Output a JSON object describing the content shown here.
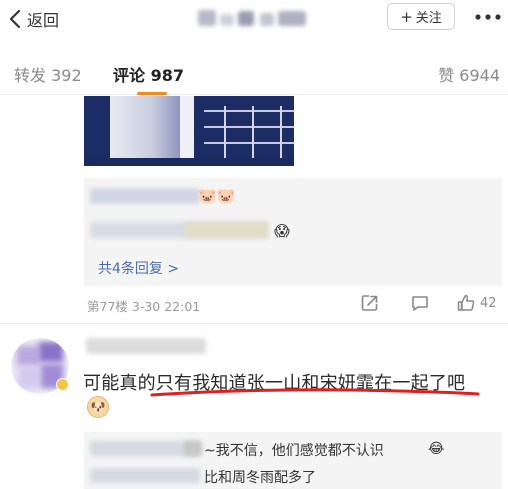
{
  "header": {
    "back_label": "返回",
    "follow_label": "关注"
  },
  "tabs": {
    "repost": "转发 392",
    "comment": "评论 987",
    "like": "赞 6944"
  },
  "prev_comment": {
    "emoji_a": "🐷🐷",
    "emoji_b": "😱",
    "more_replies": "共4条回复 >",
    "meta": "第77楼 3-30 22:01",
    "like_count": "42"
  },
  "comment": {
    "text": "可能真的只有我知道张一山和宋妍霏在一起了吧",
    "emoji": "🐶",
    "replies": [
      {
        "text": "~我不信，他们感觉都不认识",
        "emoji": "😂"
      },
      {
        "text": "比和周冬雨配多了"
      }
    ]
  },
  "colors": {
    "accent": "#f28a1c",
    "link": "#4a6fa5",
    "underline_red": "#e02020"
  }
}
